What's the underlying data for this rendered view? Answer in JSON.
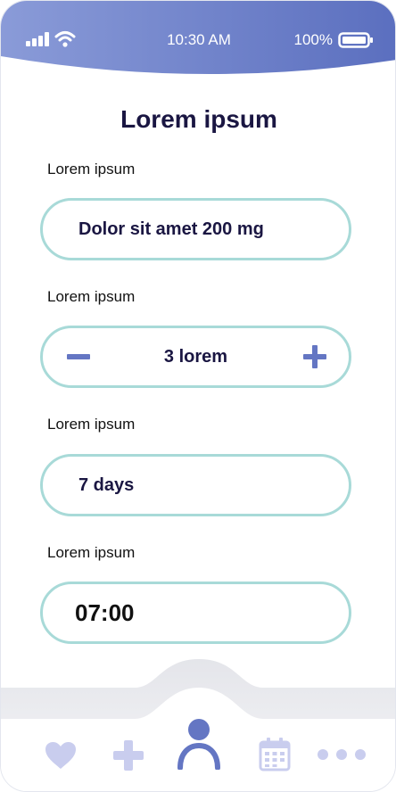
{
  "status_bar": {
    "time": "10:30 AM",
    "battery": "100%"
  },
  "screen": {
    "title": "Lorem ipsum"
  },
  "fields": {
    "medication": {
      "label": "Lorem ipsum",
      "value": "Dolor sit amet 200 mg"
    },
    "dose": {
      "label": "Lorem ipsum",
      "value": "3 lorem"
    },
    "duration": {
      "label": "Lorem ipsum",
      "value": "7 days"
    },
    "time": {
      "label": "Lorem ipsum",
      "value": "07:00"
    }
  },
  "tabbar": {
    "items": [
      {
        "icon": "heart-icon"
      },
      {
        "icon": "plus-icon"
      },
      {
        "icon": "user-icon",
        "active": true
      },
      {
        "icon": "calendar-icon"
      },
      {
        "icon": "more-icon"
      }
    ]
  },
  "colors": {
    "header_gradient_start": "#8a9bd8",
    "header_gradient_end": "#5b6fbf",
    "pill_border": "#a8dad8",
    "text_dark": "#1a1642",
    "tab_icon": "#c9cdee",
    "tab_active": "#6476c3"
  }
}
